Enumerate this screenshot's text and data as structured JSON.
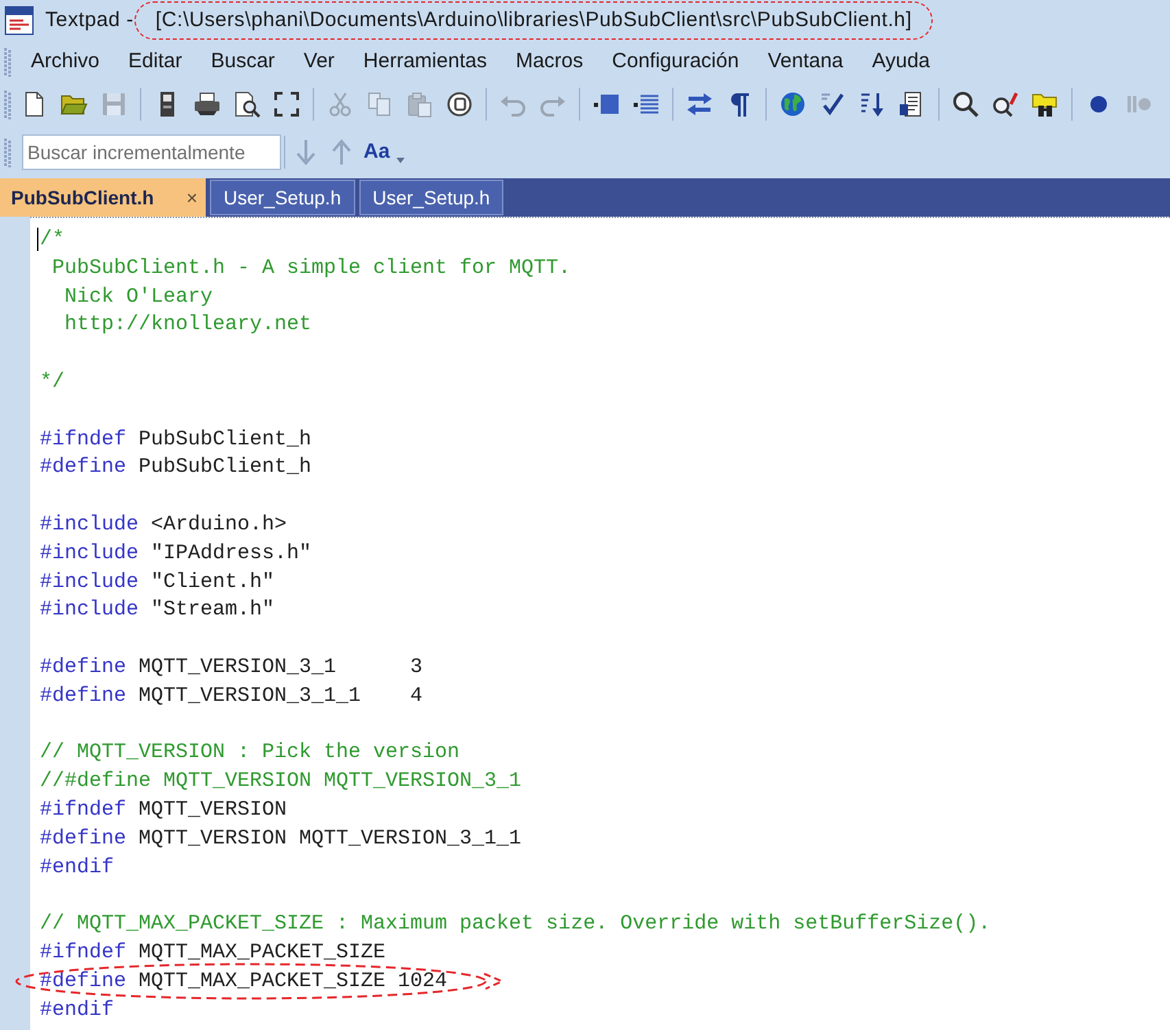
{
  "window": {
    "title": "Textpad -",
    "path": "[C:\\Users\\phani\\Documents\\Arduino\\libraries\\PubSubClient\\src\\PubSubClient.h]",
    "path_circled": true
  },
  "menu": [
    "Archivo",
    "Editar",
    "Buscar",
    "Ver",
    "Herramientas",
    "Macros",
    "Configuración",
    "Ventana",
    "Ayuda"
  ],
  "toolbar": [
    {
      "kind": "new",
      "disabled": false
    },
    {
      "kind": "open",
      "disabled": false
    },
    {
      "kind": "save",
      "disabled": true
    },
    {
      "kind": "separator"
    },
    {
      "kind": "manage",
      "disabled": false
    },
    {
      "kind": "print",
      "disabled": false
    },
    {
      "kind": "preview",
      "disabled": false
    },
    {
      "kind": "fullscreen",
      "disabled": false
    },
    {
      "kind": "separator"
    },
    {
      "kind": "cut",
      "disabled": true
    },
    {
      "kind": "copy",
      "disabled": true
    },
    {
      "kind": "paste",
      "disabled": true
    },
    {
      "kind": "insert",
      "disabled": false
    },
    {
      "kind": "separator"
    },
    {
      "kind": "undo",
      "disabled": true
    },
    {
      "kind": "redo",
      "disabled": true
    },
    {
      "kind": "separator"
    },
    {
      "kind": "indent",
      "disabled": false
    },
    {
      "kind": "outdent",
      "disabled": false
    },
    {
      "kind": "separator"
    },
    {
      "kind": "swap",
      "disabled": false
    },
    {
      "kind": "pilcrow",
      "disabled": false
    },
    {
      "kind": "separator"
    },
    {
      "kind": "globe",
      "disabled": false
    },
    {
      "kind": "spell",
      "disabled": false
    },
    {
      "kind": "sort",
      "disabled": false
    },
    {
      "kind": "document",
      "disabled": false
    },
    {
      "kind": "separator"
    },
    {
      "kind": "find",
      "disabled": false
    },
    {
      "kind": "replace",
      "disabled": false
    },
    {
      "kind": "find-files",
      "disabled": false
    },
    {
      "kind": "separator"
    },
    {
      "kind": "record",
      "disabled": false
    },
    {
      "kind": "playback",
      "disabled": true
    }
  ],
  "search_bar": {
    "placeholder": "Buscar incrementalmente",
    "buttons": [
      {
        "kind": "next",
        "disabled": true
      },
      {
        "kind": "previous",
        "disabled": true
      },
      {
        "kind": "match-case",
        "label": "Aa",
        "disabled": false
      },
      {
        "kind": "options",
        "disabled": false
      }
    ]
  },
  "tabs": [
    {
      "label": "PubSubClient.h",
      "selected": true,
      "close": "×"
    },
    {
      "label": "User_Setup.h",
      "selected": false
    },
    {
      "label": "User_Setup.h",
      "selected": false
    }
  ],
  "editor": {
    "lines": [
      {
        "kind": "code",
        "caret": true,
        "circled": false,
        "tokens": [
          {
            "kind": "comment",
            "text": "/*"
          }
        ]
      },
      {
        "kind": "code",
        "caret": false,
        "circled": false,
        "tokens": [
          {
            "kind": "comment",
            "text": " PubSubClient.h - A simple client for MQTT."
          }
        ]
      },
      {
        "kind": "code",
        "caret": false,
        "circled": false,
        "tokens": [
          {
            "kind": "comment",
            "text": "  Nick O'Leary"
          }
        ]
      },
      {
        "kind": "code",
        "caret": false,
        "circled": false,
        "tokens": [
          {
            "kind": "comment",
            "text": "  http://knolleary.net"
          }
        ]
      },
      {
        "kind": "blank"
      },
      {
        "kind": "code",
        "caret": false,
        "circled": false,
        "tokens": [
          {
            "kind": "comment",
            "text": "*/"
          }
        ]
      },
      {
        "kind": "blank"
      },
      {
        "kind": "code",
        "caret": false,
        "circled": false,
        "tokens": [
          {
            "kind": "directive",
            "text": "#ifndef"
          },
          {
            "kind": "plain",
            "text": " PubSubClient_h"
          }
        ]
      },
      {
        "kind": "code",
        "caret": false,
        "circled": false,
        "tokens": [
          {
            "kind": "directive",
            "text": "#define"
          },
          {
            "kind": "plain",
            "text": " PubSubClient_h"
          }
        ]
      },
      {
        "kind": "blank"
      },
      {
        "kind": "code",
        "caret": false,
        "circled": false,
        "tokens": [
          {
            "kind": "directive",
            "text": "#include"
          },
          {
            "kind": "plain",
            "text": " <Arduino.h>"
          }
        ]
      },
      {
        "kind": "code",
        "caret": false,
        "circled": false,
        "tokens": [
          {
            "kind": "directive",
            "text": "#include"
          },
          {
            "kind": "plain",
            "text": " \"IPAddress.h\""
          }
        ]
      },
      {
        "kind": "code",
        "caret": false,
        "circled": false,
        "tokens": [
          {
            "kind": "directive",
            "text": "#include"
          },
          {
            "kind": "plain",
            "text": " \"Client.h\""
          }
        ]
      },
      {
        "kind": "code",
        "caret": false,
        "circled": false,
        "tokens": [
          {
            "kind": "directive",
            "text": "#include"
          },
          {
            "kind": "plain",
            "text": " \"Stream.h\""
          }
        ]
      },
      {
        "kind": "blank"
      },
      {
        "kind": "code",
        "caret": false,
        "circled": false,
        "tokens": [
          {
            "kind": "directive",
            "text": "#define"
          },
          {
            "kind": "plain",
            "text": " MQTT_VERSION_3_1      3"
          }
        ]
      },
      {
        "kind": "code",
        "caret": false,
        "circled": false,
        "tokens": [
          {
            "kind": "directive",
            "text": "#define"
          },
          {
            "kind": "plain",
            "text": " MQTT_VERSION_3_1_1    4"
          }
        ]
      },
      {
        "kind": "blank"
      },
      {
        "kind": "code",
        "caret": false,
        "circled": false,
        "tokens": [
          {
            "kind": "comment",
            "text": "// MQTT_VERSION : Pick the version"
          }
        ]
      },
      {
        "kind": "code",
        "caret": false,
        "circled": false,
        "tokens": [
          {
            "kind": "comment",
            "text": "//#define MQTT_VERSION MQTT_VERSION_3_1"
          }
        ]
      },
      {
        "kind": "code",
        "caret": false,
        "circled": false,
        "tokens": [
          {
            "kind": "directive",
            "text": "#ifndef"
          },
          {
            "kind": "plain",
            "text": " MQTT_VERSION"
          }
        ]
      },
      {
        "kind": "code",
        "caret": false,
        "circled": false,
        "tokens": [
          {
            "kind": "directive",
            "text": "#define"
          },
          {
            "kind": "plain",
            "text": " MQTT_VERSION MQTT_VERSION_3_1_1"
          }
        ]
      },
      {
        "kind": "code",
        "caret": false,
        "circled": false,
        "tokens": [
          {
            "kind": "directive",
            "text": "#endif"
          }
        ]
      },
      {
        "kind": "blank"
      },
      {
        "kind": "code",
        "caret": false,
        "circled": false,
        "tokens": [
          {
            "kind": "comment",
            "text": "// MQTT_MAX_PACKET_SIZE : Maximum packet size. Override with setBufferSize()."
          }
        ]
      },
      {
        "kind": "code",
        "caret": false,
        "circled": false,
        "tokens": [
          {
            "kind": "directive",
            "text": "#ifndef"
          },
          {
            "kind": "plain",
            "text": " MQTT_MAX_PACKET_SIZE"
          }
        ]
      },
      {
        "kind": "code",
        "caret": false,
        "circled": true,
        "tokens": [
          {
            "kind": "directive",
            "text": "#define"
          },
          {
            "kind": "plain",
            "text": " MQTT_MAX_PACKET_SIZE 1024"
          }
        ]
      },
      {
        "kind": "code",
        "caret": false,
        "circled": false,
        "tokens": [
          {
            "kind": "directive",
            "text": "#endif"
          }
        ]
      }
    ]
  }
}
